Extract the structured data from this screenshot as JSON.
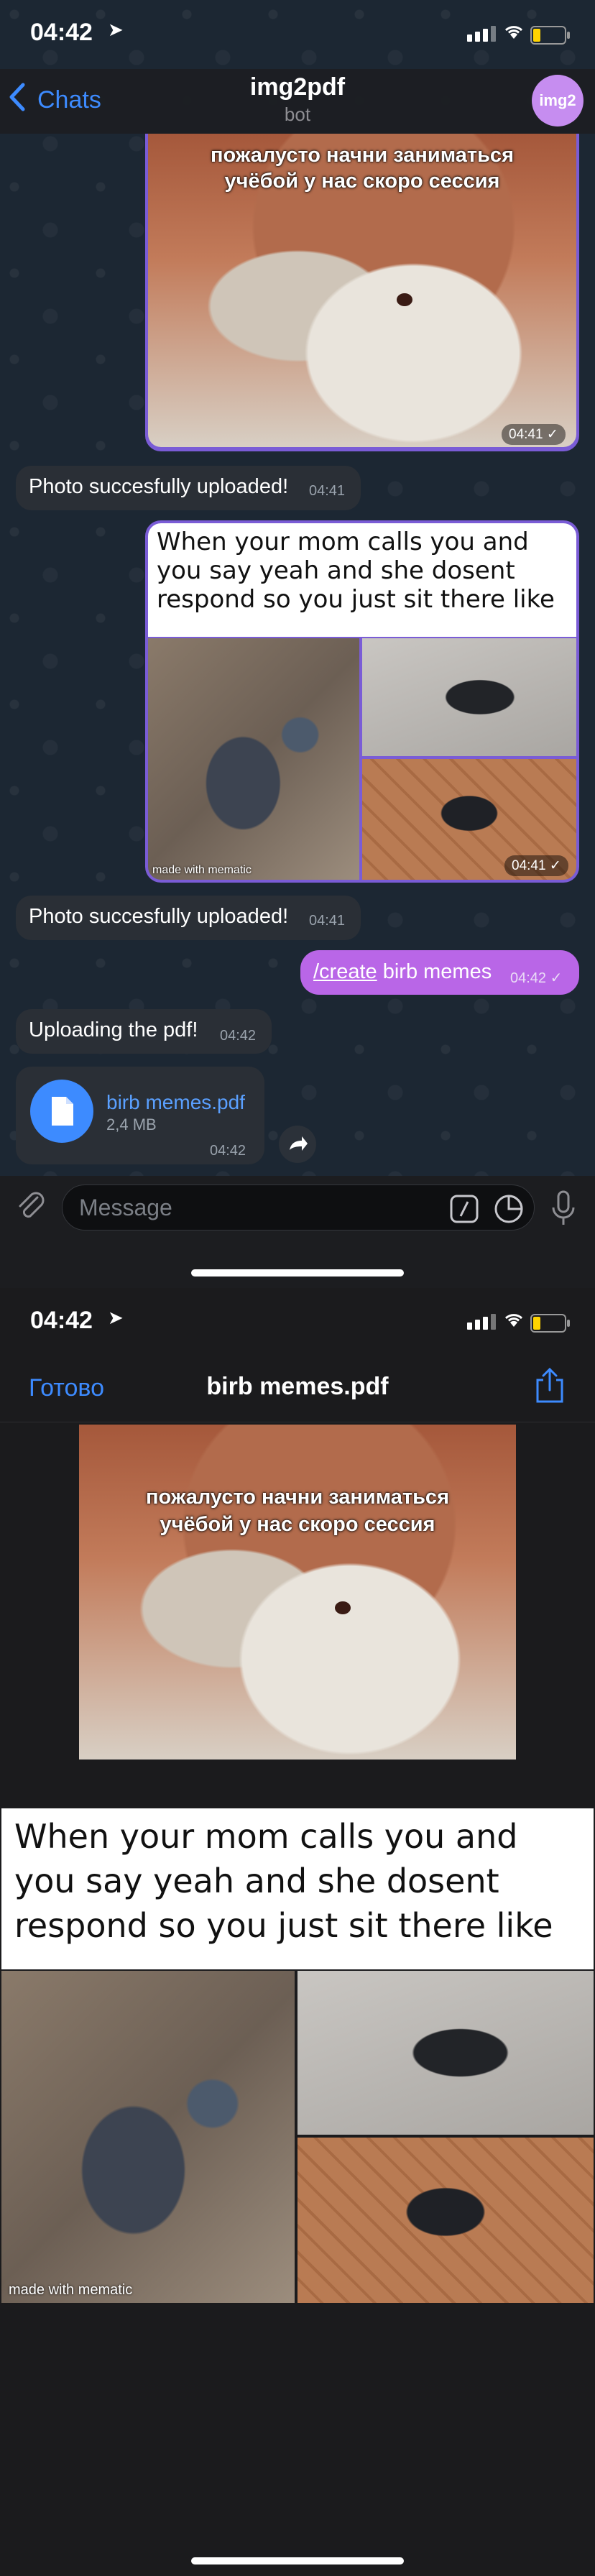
{
  "status_bar": {
    "time": "04:42",
    "location_glyph": "➤"
  },
  "chat": {
    "back_label": "Chats",
    "title": "img2pdf",
    "subtitle": "bot",
    "avatar_text": "img2"
  },
  "messages": {
    "m1": {
      "caption": "пожалусто начни заниматься учёбой у нас скоро сессия",
      "time": "04:41"
    },
    "m2": {
      "text": "Photo succesfully uploaded!",
      "time": "04:41"
    },
    "m3": {
      "meme_text": "When your mom calls you and you say yeah and she dosent respond so you just sit there like",
      "watermark": "made with mematic",
      "time": "04:41"
    },
    "m4": {
      "text": "Photo succesfully uploaded!",
      "time": "04:41"
    },
    "m5": {
      "command": "/create",
      "text": " birb memes",
      "time": "04:42"
    },
    "m6": {
      "text": "Uploading the pdf!",
      "time": "04:42"
    },
    "m7": {
      "file_name": "birb memes.pdf",
      "file_size": "2,4 MB",
      "time": "04:42"
    }
  },
  "input": {
    "placeholder": "Message"
  },
  "pdf_viewer": {
    "done_label": "Готово",
    "title": "birb memes.pdf",
    "page1_caption": "пожалусто начни заниматься учёбой у нас скоро сессия",
    "page2_text": "When your mom calls you and you say yeah and she dosent respond so you just sit there like",
    "page2_watermark": "made with mematic"
  },
  "colors": {
    "accent": "#3d8bff",
    "outgoing_bubble": "#7a5cd6",
    "command_bubble": "#b966e7",
    "incoming_bubble": "#2a2f36"
  }
}
